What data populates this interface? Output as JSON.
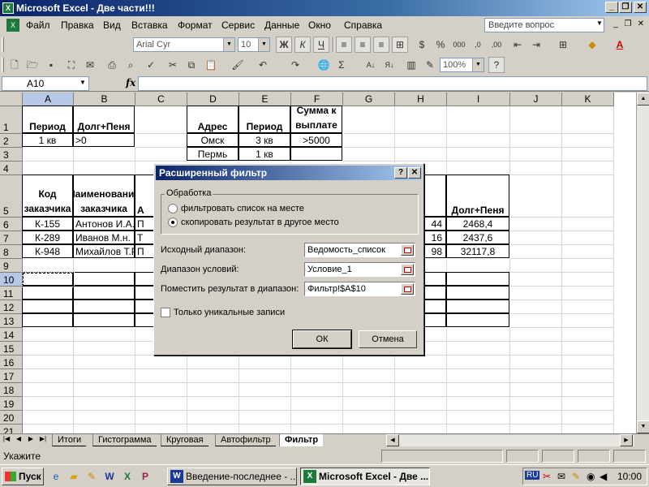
{
  "window": {
    "title": "Microsoft Excel - Две части!!!",
    "app_icon": "excel-icon",
    "controls": [
      "_",
      "❐",
      "✕"
    ]
  },
  "menu": {
    "items": [
      "Файл",
      "Правка",
      "Вид",
      "Вставка",
      "Формат",
      "Сервис",
      "Данные",
      "Окно",
      "Справка"
    ],
    "help_placeholder": "Введите вопрос",
    "doc_controls": [
      "_",
      "❐",
      "✕"
    ]
  },
  "format_toolbar": {
    "font": "Arial Cyr",
    "size": "10",
    "bold": "Ж",
    "italic": "К",
    "underline": "Ч",
    "percent": "%",
    "thousands": "000"
  },
  "standard_toolbar": {
    "zoom": "100%"
  },
  "formula_bar": {
    "name_box": "A10",
    "fx": "fx",
    "formula": ""
  },
  "grid": {
    "columns": [
      "A",
      "B",
      "C",
      "D",
      "E",
      "F",
      "G",
      "H",
      "I",
      "J",
      "K"
    ],
    "rows": [
      "1",
      "2",
      "3",
      "4",
      "5",
      "6",
      "7",
      "8",
      "9",
      "10",
      "11",
      "12",
      "13",
      "14",
      "15",
      "16",
      "17",
      "18",
      "19",
      "20",
      "21"
    ],
    "cells": {
      "A1": "Период",
      "B1": "Долг+Пеня",
      "D1": "Адрес",
      "E1": "Период",
      "F1": "Сумма к выплате",
      "A2": "1 кв",
      "B2": ">0",
      "D2": "Омск",
      "E2": "3 кв",
      "F2": ">5000",
      "D3": "Пермь",
      "E3": "1 кв",
      "A5": "Код заказчика",
      "B5": "Наименование заказчика",
      "C5": "А",
      "I5": "Долг+Пеня",
      "A6": "К-155",
      "B6": "Антонов И.А.",
      "C6": "П",
      "H6": "44",
      "I6": "2468,4",
      "A7": "К-289",
      "B7": "Иванов М.н.",
      "C7": "Т",
      "H7": "16",
      "I7": "2437,6",
      "A8": "К-948",
      "B8": "Михайлов Т.Р.",
      "C8": "П",
      "H8": "98",
      "I8": "32117,8"
    }
  },
  "sheet_tabs": {
    "tabs": [
      "Итоги",
      "Гистограмма",
      "Круговая",
      "Автофильтр",
      "Фильтр"
    ],
    "active": "Фильтр"
  },
  "status": {
    "text": "Укажите"
  },
  "dialog": {
    "title": "Расширенный фильтр",
    "help_btn": "?",
    "close_btn": "✕",
    "group_label": "Обработка",
    "option_filter_in_place": "фильтровать список на месте",
    "option_copy": "скопировать результат в другое место",
    "selected_option": "copy",
    "source_label": "Исходный диапазон:",
    "source_value": "Ведомость_список",
    "criteria_label": "Диапазон условий:",
    "criteria_value": "Условие_1",
    "dest_label": "Поместить результат в диапазон:",
    "dest_value": "Фильтр!$A$10",
    "unique_label": "Только уникальные записи",
    "unique_checked": false,
    "ok": "ОК",
    "cancel": "Отмена"
  },
  "taskbar": {
    "start": "Пуск",
    "buttons": [
      "Введение-последнее - ...",
      "Microsoft Excel - Две ..."
    ],
    "active": "Microsoft Excel - Две ...",
    "lang": "RU",
    "clock": "10:00"
  }
}
